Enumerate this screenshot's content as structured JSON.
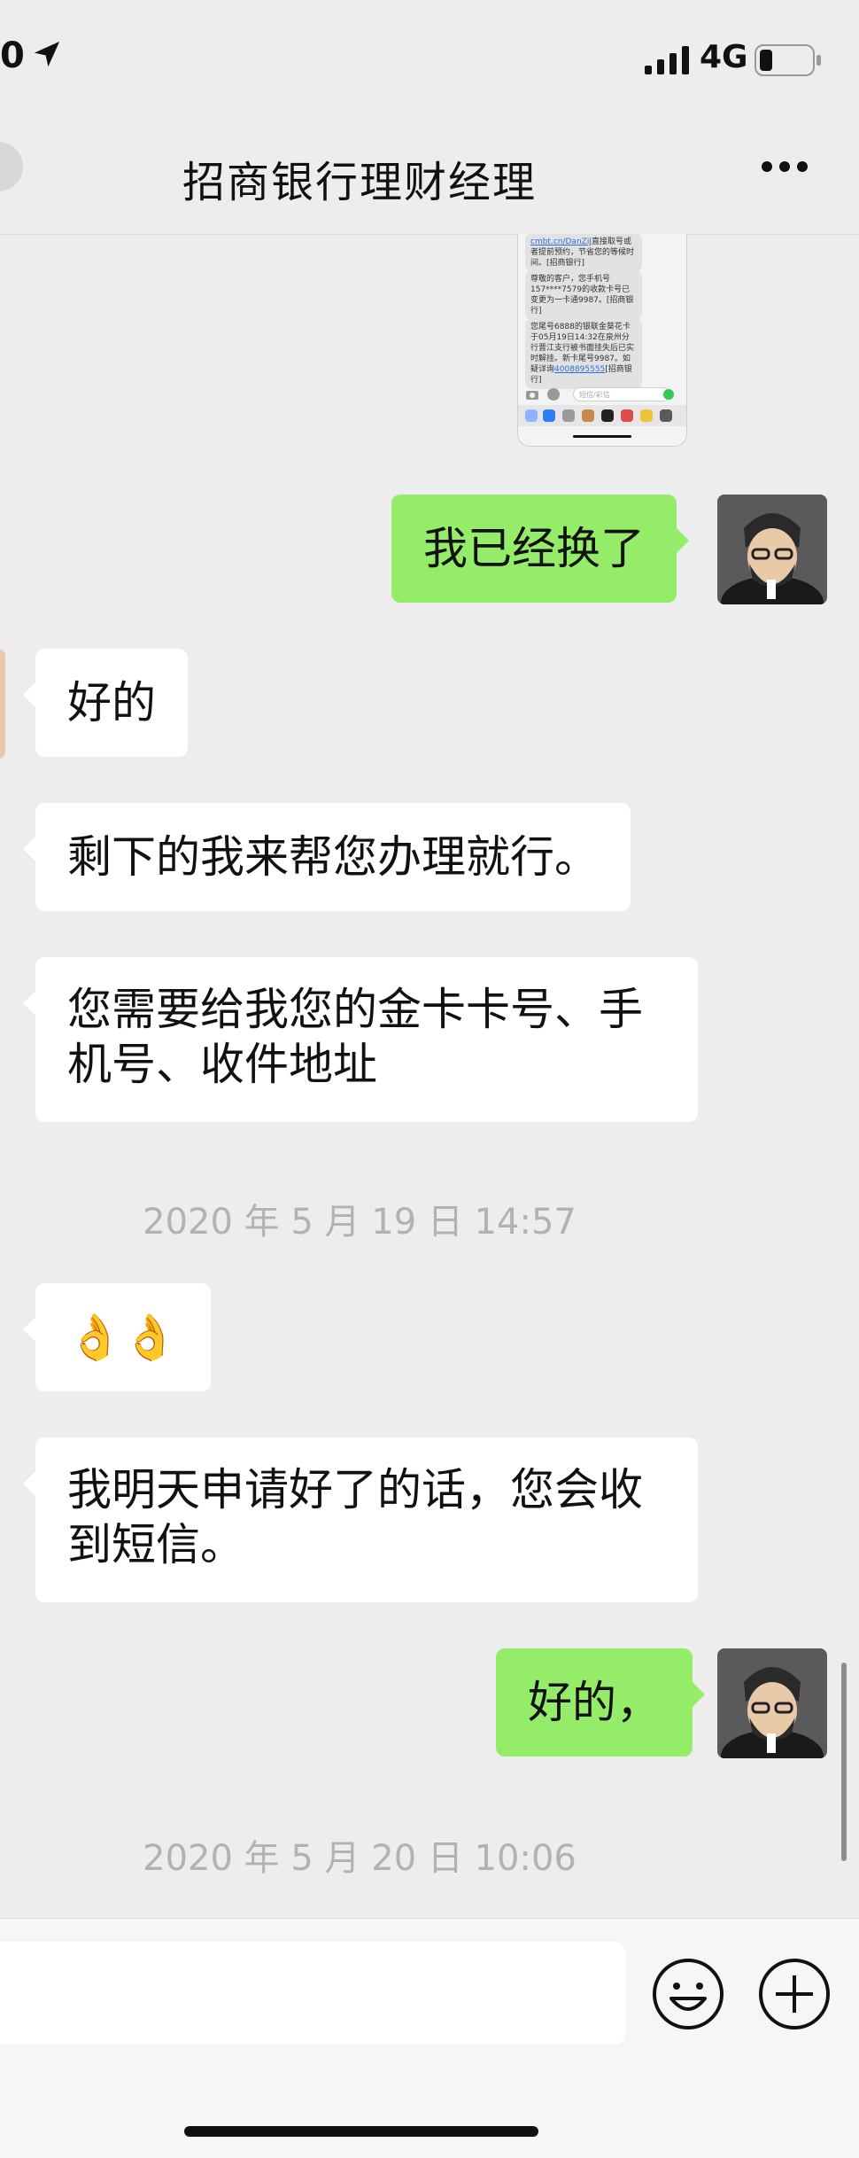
{
  "status_bar": {
    "time": "0",
    "network": "4G",
    "icons": [
      "location-arrow-icon",
      "signal-bars-icon",
      "battery-icon"
    ]
  },
  "nav": {
    "title": "招商银行理财经理",
    "back_icon": "back-chevron-icon",
    "more_icon": "more-dots-icon"
  },
  "screenshot_thumb": {
    "sms_1": {
      "link": "cmbt.cn/DanZiJ",
      "text": "直接取号或者提前预约，节省您的等候时间。[招商银行]"
    },
    "sms_2": "尊敬的客户，您手机号157****7579的收款卡号已变更为一卡通9987。[招商银行]",
    "sms_3": {
      "text": "您尾号6888的银联金葵花卡于05月19日14:32在泉州分行晋江支行被书面挂失后已实时解挂。新卡尾号9987。如疑详询",
      "link": "4008895555",
      "suffix": "[招商银行]"
    },
    "input_placeholder": "短信/彩信"
  },
  "messages": [
    {
      "side": "right",
      "text": "我已经换了"
    },
    {
      "side": "left",
      "text": "好的"
    },
    {
      "side": "left",
      "text": "剩下的我来帮您办理就行。"
    },
    {
      "side": "left",
      "lines": [
        "您需要给我您的金卡卡号、手",
        "机号、收件地址"
      ]
    },
    {
      "type": "timestamp",
      "text": "2020 年 5 月 19 日 14:57"
    },
    {
      "side": "left",
      "text": "👌👌",
      "icons": [
        "ok-hand-emoji-icon",
        "ok-hand-emoji-icon"
      ]
    },
    {
      "side": "left",
      "lines": [
        "我明天申请好了的话，您会收",
        "到短信。"
      ]
    },
    {
      "side": "right",
      "text": "好的，"
    },
    {
      "type": "timestamp",
      "text": "2020 年 5 月 20 日 10:06"
    }
  ],
  "input_bar": {
    "emoji_icon": "smiley-face-icon",
    "plus_icon": "plus-circle-icon"
  },
  "colors": {
    "background": "#ededed",
    "sent_bubble": "#95ec69",
    "received_bubble": "#ffffff",
    "timestamp_text": "#b2b2b2"
  }
}
